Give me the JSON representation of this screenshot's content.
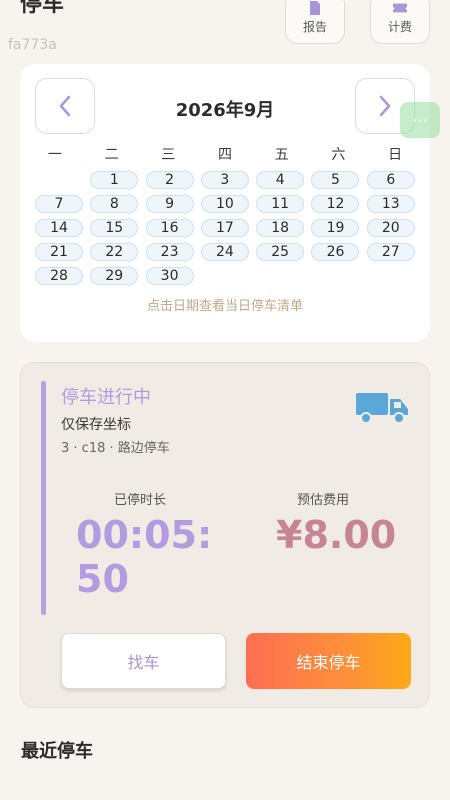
{
  "header": {
    "title": "停车",
    "report_label": "报告",
    "billing_label": "计费",
    "doc_id": "fa773a"
  },
  "calendar": {
    "title": "2026年9月",
    "weekdays": [
      "一",
      "二",
      "三",
      "四",
      "五",
      "六",
      "日"
    ],
    "days": [
      "1",
      "2",
      "3",
      "4",
      "5",
      "6",
      "7",
      "8",
      "9",
      "10",
      "11",
      "12",
      "13",
      "14",
      "15",
      "16",
      "17",
      "18",
      "19",
      "20",
      "21",
      "22",
      "23",
      "24",
      "25",
      "26",
      "27",
      "28",
      "29",
      "30"
    ],
    "hint": "点击日期查看当日停车清单",
    "prev_icon": "chevron-left-icon",
    "next_icon": "chevron-right-icon"
  },
  "active_parking": {
    "status": "停车进行中",
    "subtitle": "仅保存坐标",
    "meta": "3 · c18 · 路边停车",
    "duration_label": "已停时长",
    "duration_value": "00:05:50",
    "fee_label": "预估费用",
    "fee_value": "¥8.00",
    "find_car_label": "找车",
    "end_parking_label": "结束停车",
    "icon": "truck-icon"
  },
  "recent": {
    "title": "最近停车"
  },
  "colors": {
    "accent_purple": "#b39be0",
    "fee_pink": "#c58595",
    "end_gradient_start": "#ff6f52",
    "end_gradient_end": "#fbaa17",
    "truck_blue": "#5aa7d8"
  }
}
